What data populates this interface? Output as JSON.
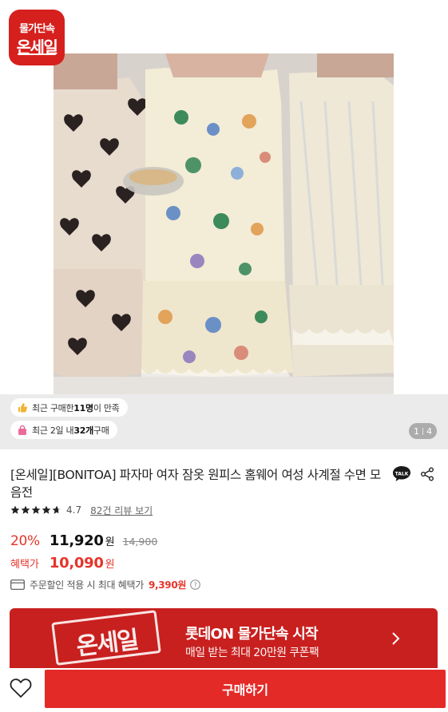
{
  "logo": {
    "line1": "물가단속",
    "line2": "온세일"
  },
  "image": {
    "badges": [
      {
        "icon": "thumbs-up-icon",
        "prefix": "최근 구매한 ",
        "count": "11명",
        "suffix": "이 만족"
      },
      {
        "icon": "shopping-bag-icon",
        "prefix": "최근 2일 내 ",
        "count": "32개",
        "suffix": " 구매"
      }
    ],
    "counter": {
      "current": "1",
      "total": "4"
    }
  },
  "product": {
    "title": "[온세일][BONITOA] 파자마 여자 잠옷 원피스 홈웨어 여성 사계절 수면 모음전",
    "rating": 4.7,
    "rating_text": "4.7",
    "review_link": "82건 리뷰 보기"
  },
  "price": {
    "discount": "20%",
    "sale": "11,920",
    "won": "원",
    "original": "14,900"
  },
  "benefit": {
    "label": "혜택가",
    "price": "10,090",
    "won": "원"
  },
  "coupon": {
    "text": "주문할인 적용 시 최대 혜택가",
    "price": "9,390원"
  },
  "banner": {
    "stamp": "온세일",
    "title": "롯데ON 물가단속 시작",
    "subtitle": "매일 받는 최대 20만원 쿠폰팩"
  },
  "bottom": {
    "buy_label": "구매하기"
  },
  "colors": {
    "accent": "#e32a27",
    "banner": "#c8201f",
    "discount": "#e5342a"
  }
}
